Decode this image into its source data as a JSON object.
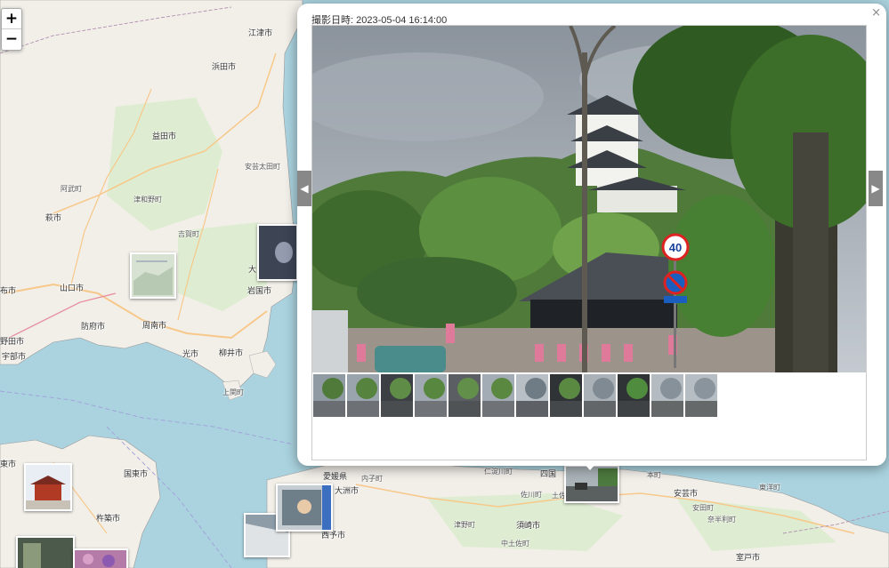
{
  "map": {
    "zoom_in_label": "+",
    "zoom_out_label": "−",
    "places": [
      {
        "label": "江津市",
        "key": "gotsu"
      },
      {
        "label": "浜田市",
        "key": "hamada"
      },
      {
        "label": "益田市",
        "key": "masuda"
      },
      {
        "label": "安芸太田町",
        "key": "akiota"
      },
      {
        "label": "阿武町",
        "key": "abu"
      },
      {
        "label": "津和野町",
        "key": "tsuwano"
      },
      {
        "label": "萩市",
        "key": "hagi"
      },
      {
        "label": "吉賀町",
        "key": "yoshika"
      },
      {
        "label": "山口市",
        "key": "yamaguchi"
      },
      {
        "label": "大",
        "key": "ootake"
      },
      {
        "label": "岩国市",
        "key": "iwakuni"
      },
      {
        "label": "布市",
        "key": "nunoshi"
      },
      {
        "label": "防府市",
        "key": "hofu"
      },
      {
        "label": "周南市",
        "key": "shunan"
      },
      {
        "label": "野田市",
        "key": "noda"
      },
      {
        "label": "宇部市",
        "key": "ube"
      },
      {
        "label": "光市",
        "key": "hikari"
      },
      {
        "label": "柳井市",
        "key": "yanai"
      },
      {
        "label": "上関町",
        "key": "kaminoseki"
      },
      {
        "label": "国東市",
        "key": "kunisaki"
      },
      {
        "label": "東市",
        "key": "higashi"
      },
      {
        "label": "杵築市",
        "key": "kitsuki"
      },
      {
        "label": "愛媛県",
        "key": "ehime"
      },
      {
        "label": "大洲市",
        "key": "ozu"
      },
      {
        "label": "内子町",
        "key": "uchiko"
      },
      {
        "label": "西予市",
        "key": "seiyo"
      },
      {
        "label": "仁淀川町",
        "key": "niyodogawa"
      },
      {
        "label": "四国",
        "key": "shikoku"
      },
      {
        "label": "佐川町",
        "key": "sakawa"
      },
      {
        "label": "土佐",
        "key": "tosa"
      },
      {
        "label": "須崎市",
        "key": "susaki"
      },
      {
        "label": "津野町",
        "key": "tsuno"
      },
      {
        "label": "中土佐町",
        "key": "nakatosa"
      },
      {
        "label": "安芸市",
        "key": "aki"
      },
      {
        "label": "安田町",
        "key": "yasuda"
      },
      {
        "label": "奈半利町",
        "key": "nahari"
      },
      {
        "label": "東洋町",
        "key": "toyo"
      },
      {
        "label": "室戸市",
        "key": "muroto"
      },
      {
        "label": "本町",
        "key": "honmachi"
      }
    ]
  },
  "popup": {
    "title": "撮影日時: 2023-05-04 16:14:00",
    "close_label": "×",
    "prev_label": "◀",
    "next_label": "▶",
    "speed_sign": "40",
    "thumbnail_count": 12
  }
}
